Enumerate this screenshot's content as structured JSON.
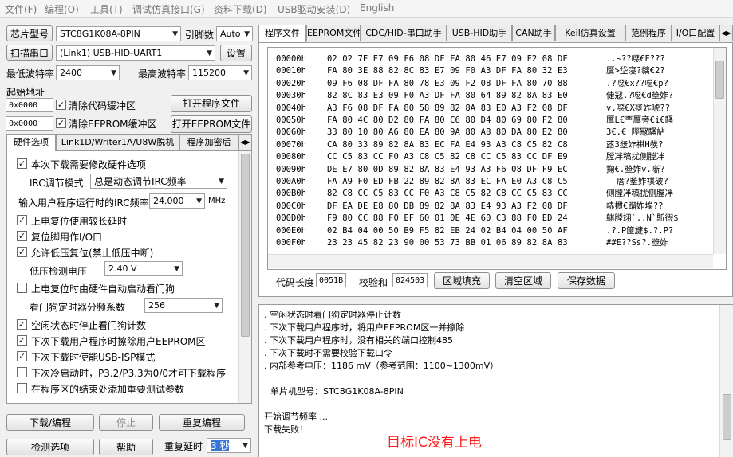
{
  "menu": [
    "文件(F)",
    "编程(O)",
    "工具(T)",
    "调试仿真接口(G)",
    "资料下载(D)",
    "USB驱动安装(D)",
    "English"
  ],
  "left": {
    "chip_type_label": "芯片型号",
    "chip_type_value": "STC8G1K08A-8PIN",
    "pin_count_label": "引脚数",
    "pin_count_value": "Auto",
    "scan_port_label": "扫描串口",
    "port_value": "(Link1) USB-HID-UART1",
    "settings_label": "设置",
    "min_baud_label": "最低波特率",
    "min_baud_value": "2400",
    "max_baud_label": "最高波特率",
    "max_baud_value": "115200",
    "start_addr_label": "起始地址",
    "code_addr": "0x0000",
    "clear_code_label": "清除代码缓冲区",
    "open_program_label": "打开程序文件",
    "eeprom_addr": "0x0000",
    "clear_eeprom_label": "清除EEPROM缓冲区",
    "open_eeprom_label": "打开EEPROM文件",
    "tabs": [
      "硬件选项",
      "Link1D/Writer1A/U8W脱机",
      "程序加密后"
    ],
    "options": {
      "hw_change": "本次下载需要修改硬件选项",
      "irc_mode_label": "IRC调节模式",
      "irc_mode_value": "总是动态调节IRC频率",
      "irc_freq_label": "输入用户程序运行时的IRC频率",
      "irc_freq_value": "24.000",
      "irc_freq_unit": "MHz",
      "power_reset": "上电复位使用较长延时",
      "reset_pin": "复位脚用作I/O口",
      "lvr": "允许低压复位(禁止低压中断)",
      "lvd_label": "低压检测电压",
      "lvd_value": "2.40 V",
      "wdt_hw": "上电复位时由硬件自动启动看门狗",
      "wdt_prescale_label": "看门狗定时器分频系数",
      "wdt_prescale_value": "256",
      "wdt_idle": "空闲状态时停止看门狗计数",
      "erase_eeprom": "下次下载用户程序时擦除用户EEPROM区",
      "isp_mode": "下次下载时使能USB-ISP模式",
      "cold_start": "下次冷启动时，P3.2/P3.3为0/0才可下载程序",
      "end_param": "在程序区的结束处添加重要测试参数"
    },
    "download_label": "下载/编程",
    "stop_label": "停止",
    "reprogram_label": "重复编程",
    "check_option_label": "检测选项",
    "help_label": "帮助",
    "repeat_delay_label": "重复延时",
    "repeat_delay_value": "3 秒"
  },
  "right_tabs": [
    "程序文件",
    "EEPROM文件",
    "CDC/HID-串口助手",
    "USB-HID助手",
    "CAN助手",
    "Keil仿真设置",
    "范例程序",
    "I/O口配置"
  ],
  "hex": [
    {
      "addr": "00000h",
      "bytes": "02 02 7E E7 09 F6 08 DF FA 80 46 E7 09 F2 08 DF",
      "ascii": "..~??噁€F???"
    },
    {
      "addr": "00010h",
      "bytes": "FA 80 3E 88 82 8C 83 E7 09 F0 A3 DF FA 80 32 E3",
      "ascii": "鷢>垈寖?黐€2?"
    },
    {
      "addr": "00020h",
      "bytes": "09 F6 08 DF FA 80 78 E3 09 F2 08 DF FA 80 70 88",
      "ascii": ".?噁€x??噁€p?"
    },
    {
      "addr": "00030h",
      "bytes": "82 8C 83 E3 09 F0 A3 DF FA 80 64 89 82 8A 83 E0",
      "ascii": "倢冦.?噁€d墏妰?"
    },
    {
      "addr": "00040h",
      "bytes": "A3 F6 08 DF FA 80 58 89 82 8A 83 E0 A3 F2 08 DF",
      "ascii": "v.噁€X墏妰唬??"
    },
    {
      "addr": "00050h",
      "bytes": "FA 80 4C 80 D2 80 FA 80 C6 80 D4 80 69 80 F2 80",
      "ascii": "鷢L€覀鷢旁€i€騷"
    },
    {
      "addr": "00060h",
      "bytes": "33 80 10 80 A6 80 EA 80 9A 80 A8 80 DA 80 E2 80",
      "ascii": "3€.€ 陘冦騷詀"
    },
    {
      "addr": "00070h",
      "bytes": "CA 80 33 89 82 8A 83 EC FA E4 93 A3 C8 C5 82 C8",
      "ascii": "蕗3墏妰祺H彂?"
    },
    {
      "addr": "00080h",
      "bytes": "CC C5 83 CC F0 A3 C8 C5 82 C8 CC C5 83 CC DF E9",
      "ascii": "膛冸稿扰侧膛冸"
    },
    {
      "addr": "00090h",
      "bytes": "DE E7 80 0D 89 82 8A 83 E4 93 A3 F6 08 DF F9 EC",
      "ascii": "掬€.墏妰v.噺?"
    },
    {
      "addr": "000A0h",
      "bytes": "FA A9 F0 ED FB 22 89 82 8A 83 EC FA E0 A3 C8 C5",
      "ascii": "  瘩?墏妰祺破?"
    },
    {
      "addr": "000B0h",
      "bytes": "82 C8 CC C5 83 CC F0 A3 C8 C5 82 C8 CC C5 83 CC",
      "ascii": "侧膛冸稿扰侧膛冸"
    },
    {
      "addr": "000C0h",
      "bytes": "DF EA DE E8 80 DB 89 82 8A 83 E4 93 A3 F2 08 DF",
      "ascii": "哧掼€蹓妰埃??"
    },
    {
      "addr": "000D0h",
      "bytes": "F9 80 CC 88 F0 EF 60 01 0E 4E 60 C3 88 F0 ED 24",
      "ascii": "鶀膛翊`..N`駈徦$"
    },
    {
      "addr": "000E0h",
      "bytes": "02 B4 04 00 50 B9 F5 82 EB 24 02 B4 04 00 50 AF",
      "ascii": ".?.P篚旔$.?.P?"
    },
    {
      "addr": "000F0h",
      "bytes": "23 23 45 82 23 90 00 53 73 BB 01 06 89 82 8A 83",
      "ascii": "##E??Ss?.墏妰"
    }
  ],
  "bottom_bar": {
    "code_length_label": "代码长度",
    "code_length_value": "0051B",
    "checksum_label": "校验和",
    "checksum_value": "024503",
    "fill_label": "区域填充",
    "clear_label": "清空区域",
    "save_label": "保存数据"
  },
  "log": [
    ". 空闲状态时看门狗定时器停止计数",
    ". 下次下载用户程序时，将用户EEPROM区一并擦除",
    ". 下次下载用户程序时，没有相关的端口控制485",
    ". 下次下载时不需要校验下载口令",
    ". 内部参考电压：1186 mV（参考范围：1100~1300mV）",
    "",
    "单片机型号：STC8G1K08A-8PIN",
    "",
    "开始调节频率 ...",
    "下载失败！"
  ],
  "overlay_text": "目标IC没有上电",
  "overlay_color": "#ff1a1a"
}
